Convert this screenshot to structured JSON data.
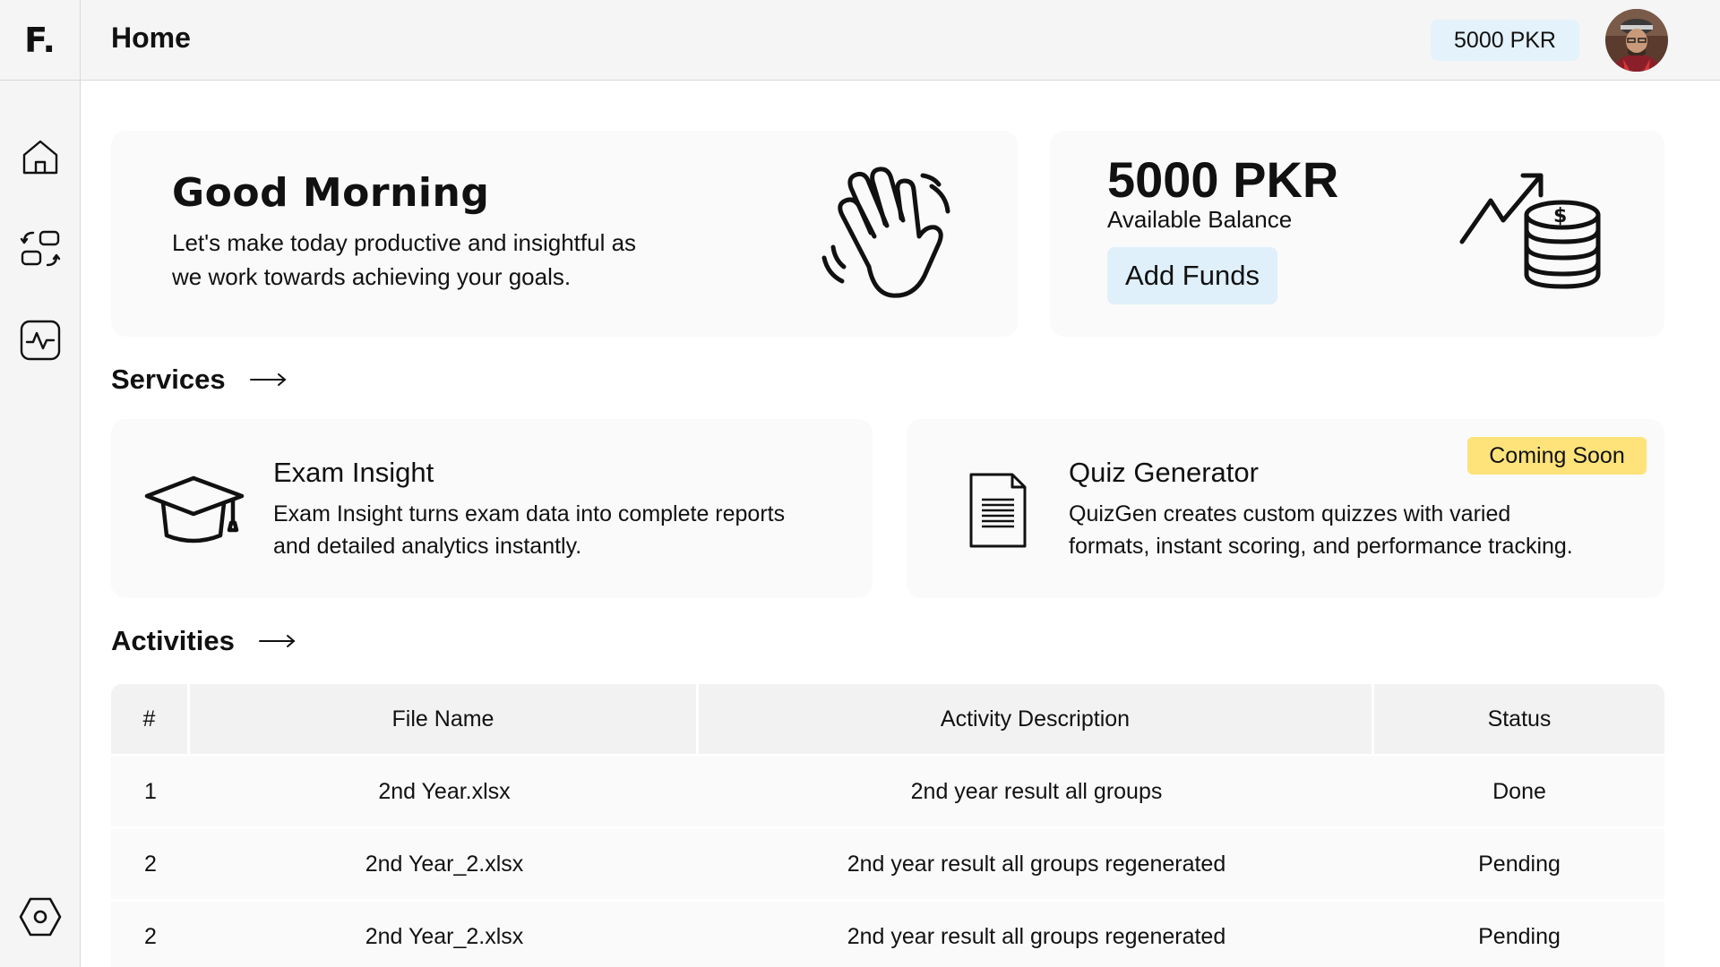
{
  "app": {
    "logo": "F.",
    "page_title": "Home"
  },
  "header": {
    "balance_pill": "5000 PKR"
  },
  "sidebar": {
    "items": [
      {
        "icon": "home-icon"
      },
      {
        "icon": "switch-apps-icon"
      },
      {
        "icon": "activity-icon"
      },
      {
        "icon": "settings-icon"
      }
    ]
  },
  "greeting": {
    "title": "Good Morning",
    "line1": "Let's make today productive and insightful as",
    "line2": "we work towards achieving your goals.",
    "icon": "waving-hand-icon"
  },
  "balance": {
    "amount": "5000 PKR",
    "label": "Available Balance",
    "add_funds": "Add Funds",
    "icon": "money-growth-icon"
  },
  "services": {
    "title": "Services",
    "items": [
      {
        "title": "Exam Insight",
        "line1": "Exam Insight turns exam data into complete reports",
        "line2": "and detailed analytics instantly.",
        "icon": "graduation-cap-icon"
      },
      {
        "title": "Quiz Generator",
        "line1": "QuizGen creates custom quizzes with varied",
        "line2": "formats, instant scoring, and performance tracking.",
        "badge": "Coming Soon",
        "icon": "document-icon"
      }
    ]
  },
  "activities": {
    "title": "Activities",
    "columns": [
      "#",
      "File Name",
      "Activity Description",
      "Status"
    ],
    "rows": [
      [
        "1",
        "2nd Year.xlsx",
        "2nd year result all groups",
        "Done"
      ],
      [
        "2",
        "2nd Year_2.xlsx",
        "2nd year result all groups regenerated",
        "Pending"
      ],
      [
        "2",
        "2nd Year_2.xlsx",
        "2nd year result all groups regenerated",
        "Pending"
      ]
    ]
  },
  "colors": {
    "pill_bg": "#e3f2fb",
    "badge_bg": "#fde37a",
    "card_bg": "#fafafa",
    "chrome_bg": "#f5f5f5"
  }
}
